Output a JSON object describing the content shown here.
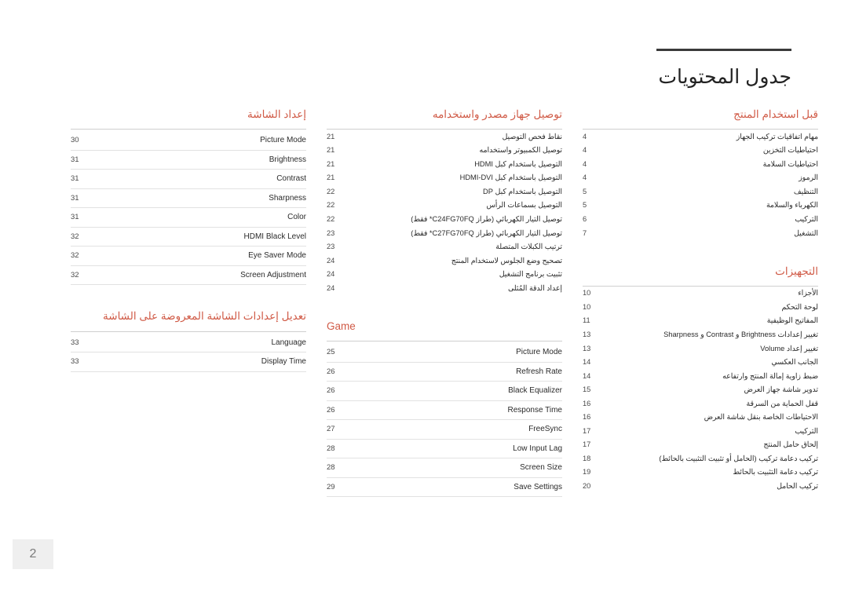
{
  "document": {
    "title": "جدول المحتويات",
    "page_number": "2"
  },
  "columns": [
    {
      "sections": [
        {
          "heading": "قبل استخدام المنتج",
          "heading_dir": "rtl",
          "dense": true,
          "rows": [
            {
              "page": "4",
              "label": "مهام اتفاقيات تركيب الجهاز",
              "dir": "rtl"
            },
            {
              "page": "4",
              "label": "احتياطيات التخزين",
              "dir": "rtl"
            },
            {
              "page": "4",
              "label": "احتياطيات السلامة",
              "dir": "rtl"
            },
            {
              "page": "4",
              "label": "الرموز",
              "dir": "rtl"
            },
            {
              "page": "5",
              "label": "التنظيف",
              "dir": "rtl"
            },
            {
              "page": "5",
              "label": "الكهرباء والسلامة",
              "dir": "rtl"
            },
            {
              "page": "6",
              "label": "التركيب",
              "dir": "rtl"
            },
            {
              "page": "7",
              "label": "التشغيل",
              "dir": "rtl"
            }
          ]
        },
        {
          "heading": "التجهيزات",
          "heading_dir": "rtl",
          "dense": true,
          "rows": [
            {
              "page": "10",
              "label": "الأجزاء",
              "dir": "rtl"
            },
            {
              "page": "10",
              "label": "لوحة التحكم",
              "dir": "rtl"
            },
            {
              "page": "11",
              "label": "المفاتيح الوظيفية",
              "dir": "rtl"
            },
            {
              "page": "13",
              "label": "تغيير إعدادات Brightness و Contrast و Sharpness",
              "dir": "rtl"
            },
            {
              "page": "13",
              "label": "تغيير إعداد Volume",
              "dir": "rtl"
            },
            {
              "page": "14",
              "label": "الجانب العكسي",
              "dir": "rtl"
            },
            {
              "page": "14",
              "label": "ضبط زاوية إمالة المنتج وارتفاعه",
              "dir": "rtl"
            },
            {
              "page": "15",
              "label": "تدوير شاشة جهاز العرض",
              "dir": "rtl"
            },
            {
              "page": "16",
              "label": "قفل الحماية من السرقة",
              "dir": "rtl"
            },
            {
              "page": "16",
              "label": "الاحتياطات الخاصة بنقل شاشة العرض",
              "dir": "rtl"
            },
            {
              "page": "17",
              "label": "التركيب",
              "dir": "rtl"
            },
            {
              "page": "17",
              "label": "إلحاق حامل المنتج",
              "dir": "rtl"
            },
            {
              "page": "18",
              "label": "تركيب دعامة تركيب (الحامل أو تثبيت التثبيت بالحائط)",
              "dir": "rtl"
            },
            {
              "page": "19",
              "label": "تركيب دعامة التثبيت بالحائط",
              "dir": "rtl"
            },
            {
              "page": "20",
              "label": "تركيب الحامل",
              "dir": "rtl"
            }
          ]
        }
      ]
    },
    {
      "sections": [
        {
          "heading": "توصيل جهاز مصدر واستخدامه",
          "heading_dir": "rtl",
          "dense": true,
          "rows": [
            {
              "page": "21",
              "label": "نقاط فحص التوصيل",
              "dir": "rtl"
            },
            {
              "page": "21",
              "label": "توصيل الكمبيوتر واستخدامه",
              "dir": "rtl"
            },
            {
              "page": "21",
              "label": "التوصيل باستخدام كبل HDMI",
              "dir": "rtl"
            },
            {
              "page": "21",
              "label": "التوصيل باستخدام كبل HDMI-DVI",
              "dir": "rtl"
            },
            {
              "page": "22",
              "label": "التوصيل باستخدام كبل DP",
              "dir": "rtl"
            },
            {
              "page": "22",
              "label": "التوصيل بسماعات الرأس",
              "dir": "rtl"
            },
            {
              "page": "22",
              "label": "توصيل التيار الكهربائي (طراز C24FG70FQ* فقط)",
              "dir": "rtl"
            },
            {
              "page": "23",
              "label": "توصيل التيار الكهربائي (طراز C27FG70FQ* فقط)",
              "dir": "rtl"
            },
            {
              "page": "23",
              "label": "ترتيب الكبلات المتصلة",
              "dir": "rtl"
            },
            {
              "page": "24",
              "label": "تصحيح وضع الجلوس لاستخدام المنتج",
              "dir": "rtl"
            },
            {
              "page": "24",
              "label": "تثبيت برنامج التشغيل",
              "dir": "rtl"
            },
            {
              "page": "24",
              "label": "إعداد الدقة المُثلى",
              "dir": "rtl"
            }
          ]
        },
        {
          "heading": "Game",
          "heading_dir": "ltr",
          "dense": false,
          "rows": [
            {
              "page": "25",
              "label": "Picture Mode",
              "dir": "ltr"
            },
            {
              "page": "26",
              "label": "Refresh Rate",
              "dir": "ltr"
            },
            {
              "page": "26",
              "label": "Black Equalizer",
              "dir": "ltr"
            },
            {
              "page": "26",
              "label": "Response Time",
              "dir": "ltr"
            },
            {
              "page": "27",
              "label": "FreeSync",
              "dir": "ltr"
            },
            {
              "page": "28",
              "label": "Low Input Lag",
              "dir": "ltr"
            },
            {
              "page": "28",
              "label": "Screen Size",
              "dir": "ltr"
            },
            {
              "page": "29",
              "label": "Save Settings",
              "dir": "ltr"
            }
          ]
        }
      ]
    },
    {
      "sections": [
        {
          "heading": "إعداد الشاشة",
          "heading_dir": "rtl",
          "dense": false,
          "rows": [
            {
              "page": "30",
              "label": "Picture Mode",
              "dir": "ltr"
            },
            {
              "page": "31",
              "label": "Brightness",
              "dir": "ltr"
            },
            {
              "page": "31",
              "label": "Contrast",
              "dir": "ltr"
            },
            {
              "page": "31",
              "label": "Sharpness",
              "dir": "ltr"
            },
            {
              "page": "31",
              "label": "Color",
              "dir": "ltr"
            },
            {
              "page": "32",
              "label": "HDMI Black Level",
              "dir": "ltr"
            },
            {
              "page": "32",
              "label": "Eye Saver Mode",
              "dir": "ltr"
            },
            {
              "page": "32",
              "label": "Screen Adjustment",
              "dir": "ltr"
            }
          ]
        },
        {
          "heading": "تعديل إعدادات الشاشة المعروضة على الشاشة",
          "heading_dir": "rtl",
          "dense": false,
          "rows": [
            {
              "page": "33",
              "label": "Language",
              "dir": "ltr"
            },
            {
              "page": "33",
              "label": "Display Time",
              "dir": "ltr"
            }
          ]
        }
      ]
    }
  ]
}
